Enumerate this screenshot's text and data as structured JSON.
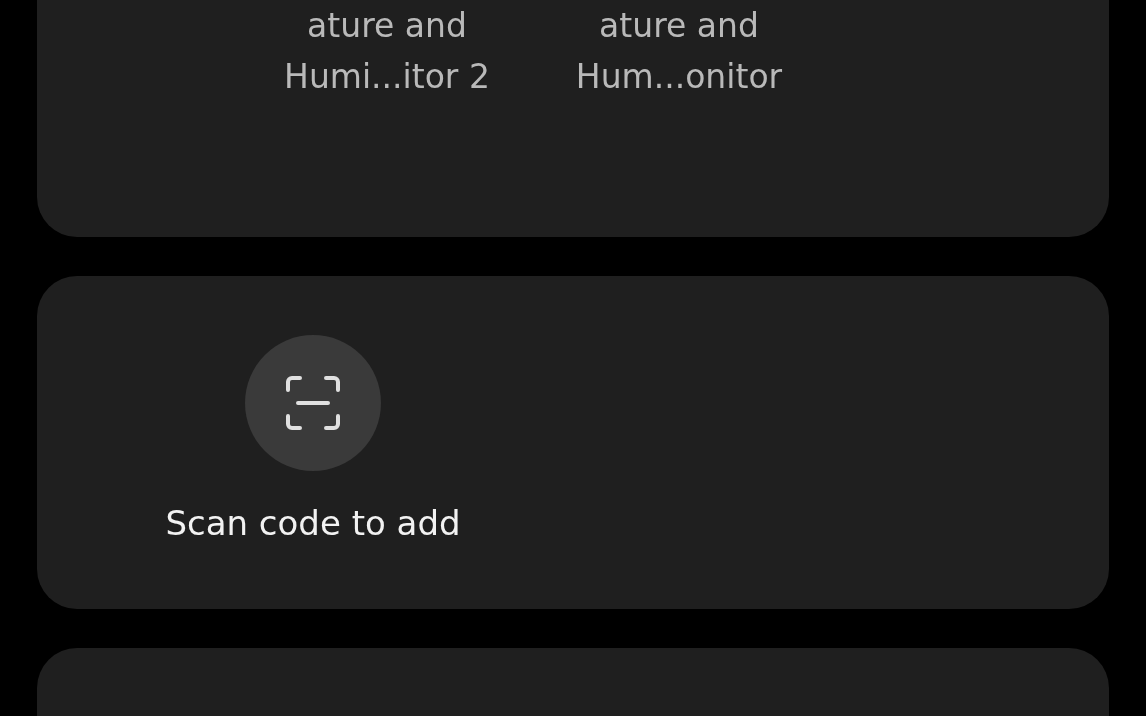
{
  "devices": [
    {
      "name_lines": [
        "ature and",
        "Humi...itor 2"
      ]
    },
    {
      "name_lines": [
        "ature and",
        "Hum...onitor"
      ]
    }
  ],
  "scan_card": {
    "label": "Scan code to add"
  }
}
